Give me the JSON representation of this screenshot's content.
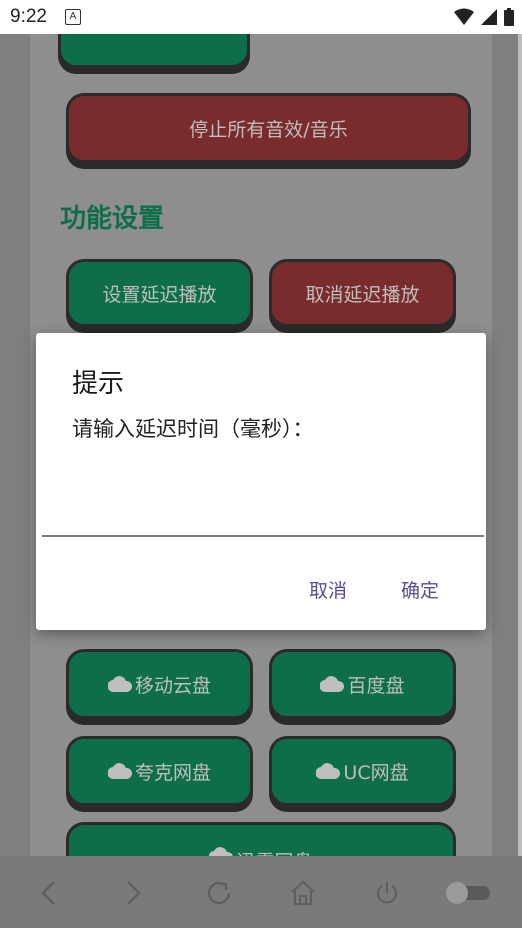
{
  "status": {
    "time": "9:22",
    "notification_glyph": "A"
  },
  "buttons": {
    "stop_all": "停止所有音效/音乐",
    "set_delay": "设置延迟播放",
    "cancel_delay": "取消延迟播放",
    "mobile_cloud": "移动云盘",
    "baidu": "百度盘",
    "quark": "夸克网盘",
    "uc": "UC网盘",
    "xunlei": "迅雷网盘"
  },
  "section": {
    "title": "功能设置"
  },
  "dialog": {
    "title": "提示",
    "message": "请输入延迟时间（毫秒）：",
    "input_value": "",
    "cancel": "取消",
    "confirm": "确定"
  },
  "nav": {
    "icons": [
      "back-icon",
      "forward-icon",
      "refresh-icon",
      "home-icon",
      "power-icon",
      "toggle-switch"
    ]
  },
  "colors": {
    "green_button": "#0f6e4a",
    "red_button": "#7a2b2b",
    "dialog_action": "#5b4b96"
  }
}
